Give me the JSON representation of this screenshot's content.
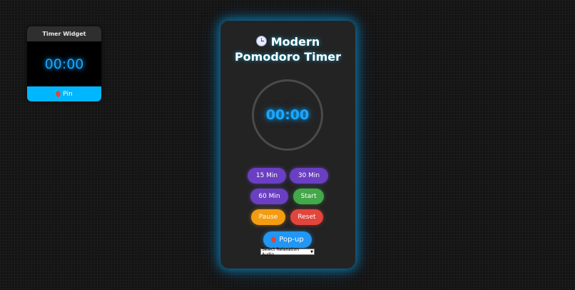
{
  "widget": {
    "title": "Timer Widget",
    "time": "00:00",
    "pin_label": "Pin"
  },
  "timer": {
    "title_line1": "Modern",
    "title_line2": "Pomodoro Timer",
    "time": "00:00"
  },
  "buttons": {
    "min15": "15 Min",
    "min30": "30 Min",
    "min60": "60 Min",
    "start": "Start",
    "pause": "Pause",
    "reset": "Reset",
    "popup": "Pop-up"
  },
  "audio_select": {
    "selected": "Select Relaxation Audio"
  },
  "colors": {
    "accent": "#1ea7ff",
    "purple": "#6a3fc2",
    "green": "#43a84a",
    "orange": "#f39c12",
    "red": "#e2453c",
    "blue": "#2196f3",
    "pin_bar": "#00b7ff"
  },
  "icons": {
    "title_icon": "alarm-clock-icon",
    "pin_icon": "pushpin-icon",
    "popup_icon": "pushpin-icon"
  }
}
